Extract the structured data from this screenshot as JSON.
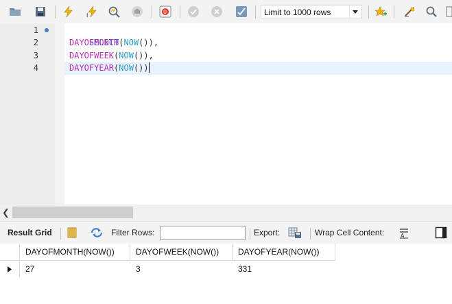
{
  "toolbar": {
    "limit_select": "Limit to 1000 rows",
    "buttons": [
      "open-folder-icon",
      "save-icon",
      "execute-icon",
      "execute-current-icon",
      "explain-icon",
      "stop-icon",
      "toggle-error-icon",
      "commit-icon",
      "rollback-icon",
      "autocommit-icon",
      "add-snippet-icon",
      "beautify-icon",
      "find-icon"
    ]
  },
  "editor": {
    "line_numbers": [
      "1",
      "2",
      "3",
      "4"
    ],
    "lines": [
      {
        "kw": "SELECT"
      },
      {
        "fn": "DAYOFMONTH",
        "open": "(",
        "inner": "NOW",
        "close": "()),"
      },
      {
        "fn": "DAYOFWEEK",
        "open": "(",
        "inner": "NOW",
        "close": "()),"
      },
      {
        "fn": "DAYOFYEAR",
        "open": "(",
        "inner": "NOW",
        "close": "())"
      }
    ]
  },
  "result_bar": {
    "result_grid": "Result Grid",
    "filter_rows": "Filter Rows:",
    "filter_value": "",
    "export": "Export:",
    "wrap_cell": "Wrap Cell Content:"
  },
  "grid": {
    "columns": [
      "DAYOFMONTH(NOW())",
      "DAYOFWEEK(NOW())",
      "DAYOFYEAR(NOW())"
    ],
    "rows": [
      [
        "27",
        "3",
        "331"
      ]
    ]
  },
  "colors": {
    "keyword": "#3b64d6",
    "function": "#b42fb1",
    "builtin": "#2d9ac4"
  }
}
